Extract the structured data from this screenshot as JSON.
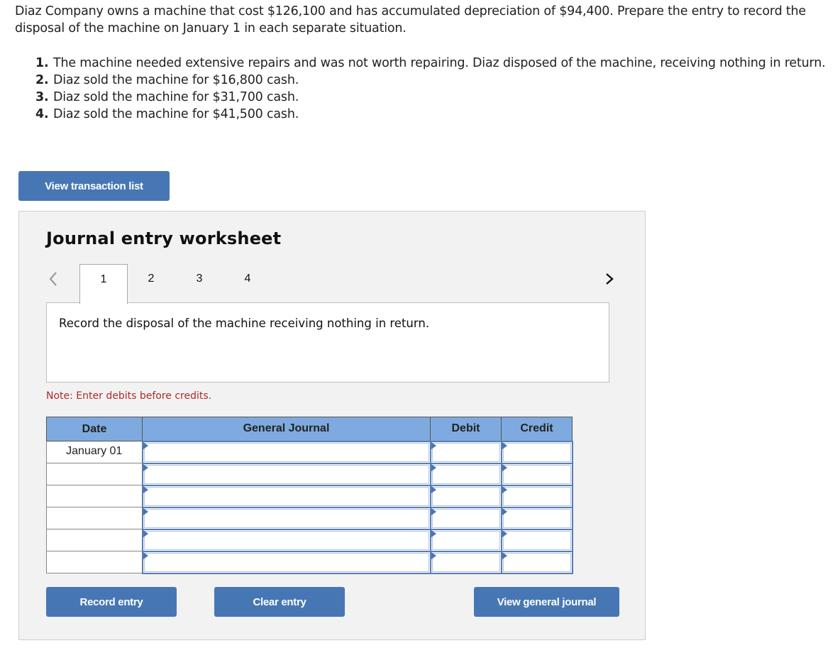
{
  "question": {
    "intro": "Diaz Company owns a machine that cost $126,100 and has accumulated depreciation of $94,400. Prepare the entry to record the disposal of the machine on January 1 in each separate situation.",
    "situations": [
      {
        "num": "1.",
        "text": "The machine needed extensive repairs and was not worth repairing. Diaz disposed of the machine, receiving nothing in return."
      },
      {
        "num": "2.",
        "text": "Diaz sold the machine for $16,800 cash."
      },
      {
        "num": "3.",
        "text": "Diaz sold the machine for $31,700 cash."
      },
      {
        "num": "4.",
        "text": "Diaz sold the machine for $41,500 cash."
      }
    ]
  },
  "buttons": {
    "view_transaction_list": "View transaction list",
    "record_entry": "Record entry",
    "clear_entry": "Clear entry",
    "view_general_journal": "View general journal"
  },
  "worksheet": {
    "title": "Journal entry worksheet",
    "nav_prev_icon": "chevron-left-icon",
    "nav_next_icon": "chevron-right-icon",
    "tabs": [
      "1",
      "2",
      "3",
      "4"
    ],
    "active_tab": "1",
    "prompt": "Record the disposal of the machine receiving nothing in return.",
    "note": "Note: Enter debits before credits."
  },
  "journal": {
    "headers": {
      "date": "Date",
      "account": "General Journal",
      "debit": "Debit",
      "credit": "Credit"
    },
    "rows": [
      {
        "date": "January 01",
        "account": "",
        "debit": "",
        "credit": ""
      },
      {
        "date": "",
        "account": "",
        "debit": "",
        "credit": ""
      },
      {
        "date": "",
        "account": "",
        "debit": "",
        "credit": ""
      },
      {
        "date": "",
        "account": "",
        "debit": "",
        "credit": ""
      },
      {
        "date": "",
        "account": "",
        "debit": "",
        "credit": ""
      },
      {
        "date": "",
        "account": "",
        "debit": "",
        "credit": ""
      }
    ]
  },
  "colors": {
    "button_bg": "#4776b4",
    "header_bg": "#7eaadf",
    "note_text": "#b02a2a",
    "panel_bg": "#f2f2f2"
  }
}
